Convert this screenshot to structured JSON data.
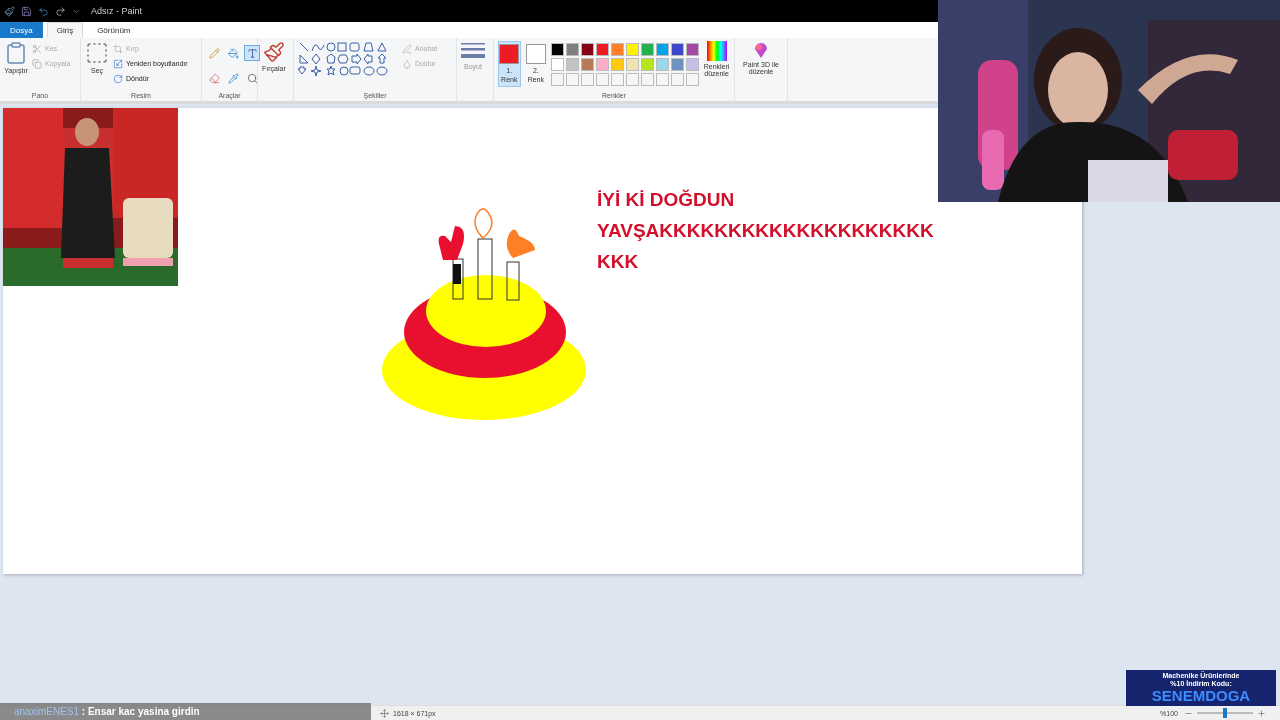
{
  "title_bar": {
    "title": "Adsız - Paint"
  },
  "tabs": [
    {
      "label": "Dosya",
      "kind": "file",
      "selected": false
    },
    {
      "label": "Giriş",
      "kind": "tab",
      "selected": true
    },
    {
      "label": "Görünüm",
      "kind": "tab",
      "selected": false
    }
  ],
  "clipboard": {
    "label": "Pano",
    "paste": "Yapıştır",
    "items": [
      {
        "label": "Kes",
        "kind": "cut",
        "disabled": true
      },
      {
        "label": "Kopyala",
        "kind": "copy",
        "disabled": true
      }
    ]
  },
  "image": {
    "label": "Resim",
    "select": "Seç",
    "items": [
      {
        "label": "Kırp",
        "kind": "crop",
        "disabled": true
      },
      {
        "label": "Yeniden boyutlandır",
        "kind": "resize",
        "disabled": false
      },
      {
        "label": "Döndür",
        "kind": "rotate",
        "disabled": false
      }
    ]
  },
  "tools": {
    "label": "Araçlar",
    "items": [
      {
        "kind": "pencil",
        "selected": false
      },
      {
        "kind": "fill",
        "selected": false
      },
      {
        "kind": "text",
        "selected": true
      },
      {
        "kind": "eraser",
        "selected": false
      },
      {
        "kind": "picker",
        "selected": false
      },
      {
        "kind": "magnifier",
        "selected": false
      }
    ]
  },
  "brushes": {
    "label": "Fırçalar"
  },
  "shapes": {
    "label": "Şekiller",
    "options": [
      {
        "label": "Anahat",
        "kind": "outline",
        "disabled": true
      },
      {
        "label": "Doldur",
        "kind": "fill",
        "disabled": true
      }
    ]
  },
  "size": {
    "label": "Boyut",
    "disabled": true
  },
  "colors": {
    "label": "Renkler",
    "current": [
      {
        "number": "1.",
        "label": "Renk",
        "color": "#ed1c24",
        "selected": true
      },
      {
        "number": "2.",
        "label": "Renk",
        "color": "#ffffff",
        "selected": false
      }
    ],
    "palette": [
      {
        "color": "#000000"
      },
      {
        "color": "#7f7f7f"
      },
      {
        "color": "#880015"
      },
      {
        "color": "#ed1c24"
      },
      {
        "color": "#ff7f27"
      },
      {
        "color": "#fff200"
      },
      {
        "color": "#22b14c"
      },
      {
        "color": "#00a2e8"
      },
      {
        "color": "#3f48cc"
      },
      {
        "color": "#a349a4"
      },
      {
        "color": "#ffffff"
      },
      {
        "color": "#c3c3c3"
      },
      {
        "color": "#b97a57"
      },
      {
        "color": "#ffaec9"
      },
      {
        "color": "#ffc90e"
      },
      {
        "color": "#efe4b0"
      },
      {
        "color": "#b5e61d"
      },
      {
        "color": "#99d9ea"
      },
      {
        "color": "#7092be"
      },
      {
        "color": "#c8bfe7"
      }
    ],
    "edit": "Renkleri düzenle"
  },
  "paint3d": {
    "label": "Paint 3D ile düzenle"
  },
  "canvas": {
    "text": [
      "İYİ Kİ DOĞDUN",
      "YAVŞAKKKKKKKKKKKKKKKKKKKK",
      "KKK"
    ]
  },
  "status_bar": {
    "canvas_size": "1618 × 671px",
    "zoom": "%100",
    "level": 0.5
  },
  "chat": {
    "user": "anaximENES1",
    "message": ": Ensar kac yasina girdin"
  },
  "ad": {
    "line_1": "Machenike Ürünlerinde",
    "line_2": "%10 İndirim Kodu:",
    "code": "SENEMDOGA"
  }
}
